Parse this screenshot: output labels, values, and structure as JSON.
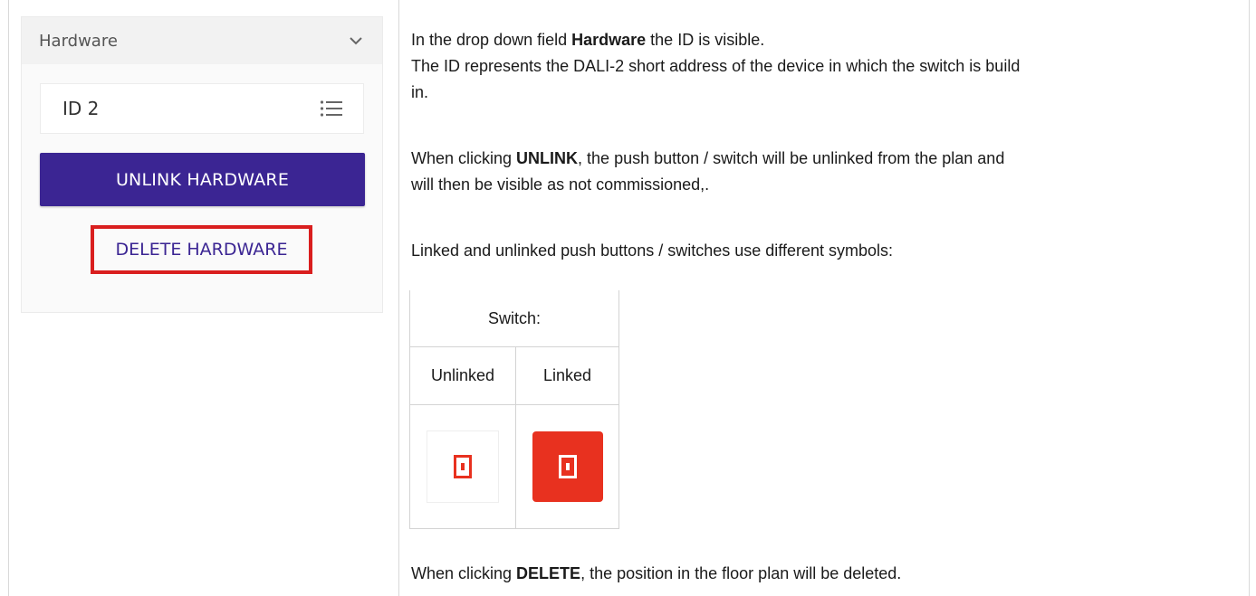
{
  "panel": {
    "hardware_label": "Hardware",
    "id_value": "ID 2",
    "unlink_button": "UNLINK HARDWARE",
    "delete_button": "DELETE HARDWARE"
  },
  "colors": {
    "accent": "#3b2593",
    "highlight": "#d91e1e",
    "switch_red": "#e8311f"
  },
  "icons": {
    "dropdown": "chevron-down-icon",
    "list": "list-icon",
    "switch": "switch-icon"
  },
  "text": {
    "p1_pre": "In the drop down field ",
    "p1_bold": "Hardware",
    "p1_post": " the ID is visible.",
    "p2_line1": "The ID represents the DALI-2 short address of the device in which the switch is build",
    "p2_line2": "in.",
    "p3_pre": "When clicking ",
    "p3_bold": "UNLINK",
    "p3_post": ", the push button / switch will be unlinked from the plan and",
    "p3_line2": "will then be visible as not commissioned,.",
    "p4": "Linked and unlinked push buttons / switches use different symbols:",
    "p5_pre": "When clicking ",
    "p5_bold": "DELETE",
    "p5_post": ", the position in the floor plan will be deleted."
  },
  "table": {
    "title": "Switch:",
    "col_unlinked": "Unlinked",
    "col_linked": "Linked"
  }
}
